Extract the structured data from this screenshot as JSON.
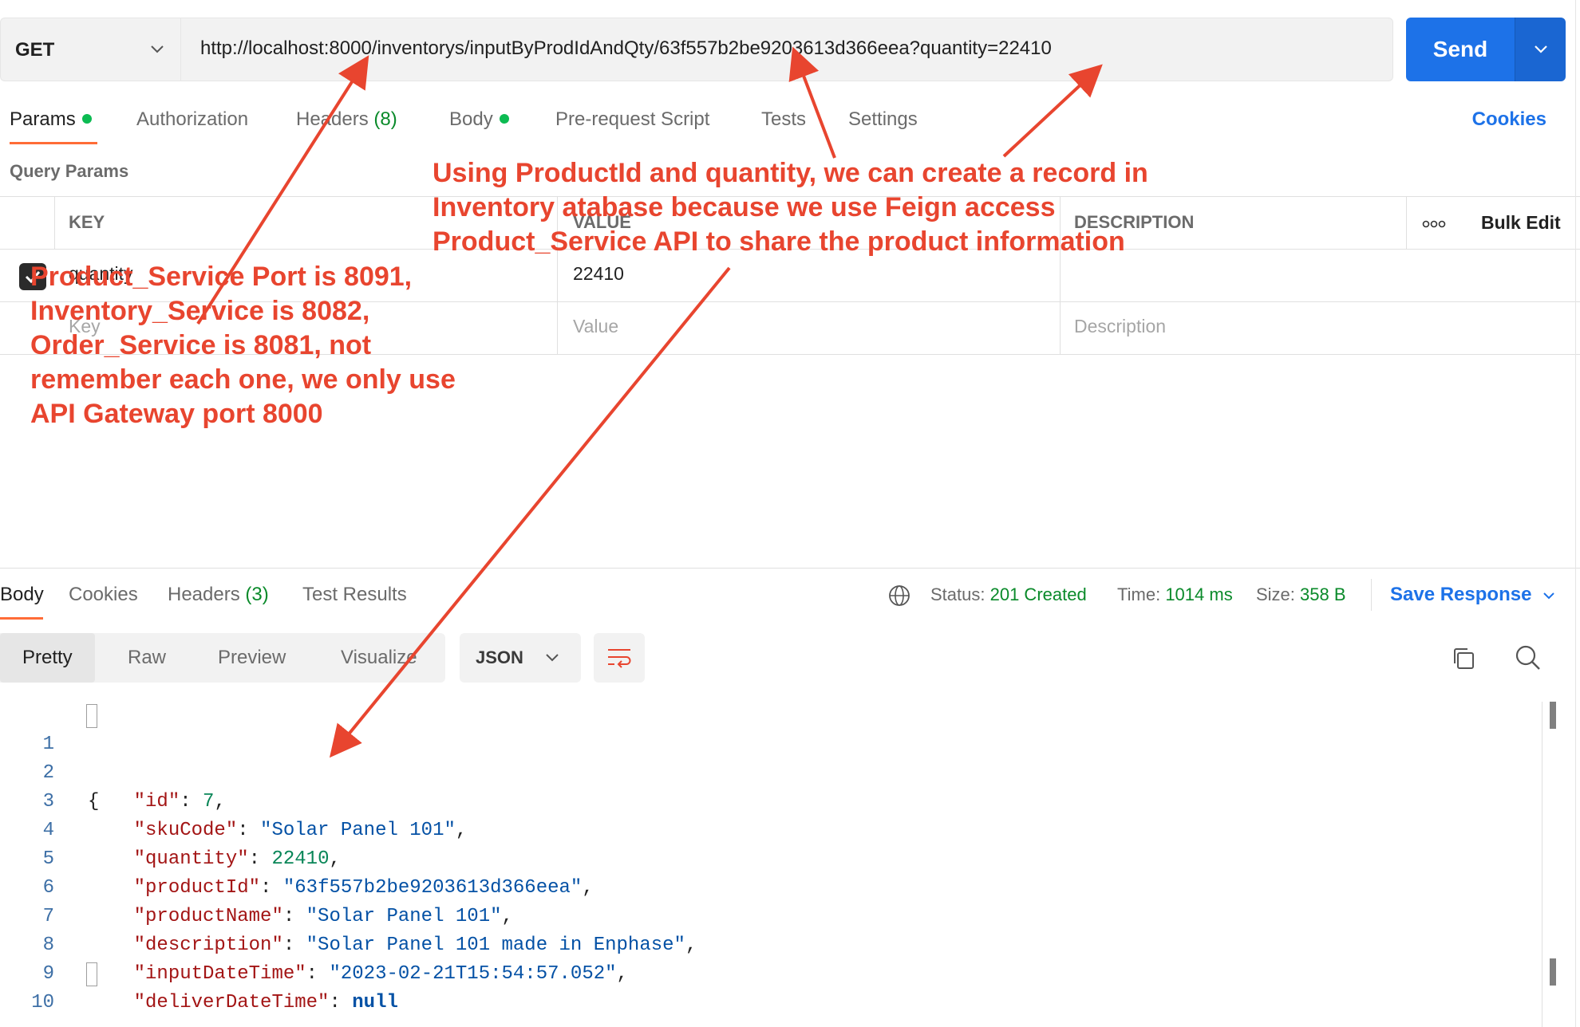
{
  "request": {
    "method": "GET",
    "url": "http://localhost:8000/inventorys/inputByProdIdAndQty/63f557b2be9203613d366eea?quantity=22410",
    "send_label": "Send"
  },
  "request_tabs": {
    "params": "Params",
    "authorization": "Authorization",
    "headers": "Headers",
    "headers_count": "(8)",
    "body": "Body",
    "pre_request": "Pre-request Script",
    "tests": "Tests",
    "settings": "Settings",
    "cookies": "Cookies"
  },
  "query_params": {
    "title": "Query Params",
    "headers": {
      "key": "KEY",
      "value": "VALUE",
      "description": "DESCRIPTION",
      "bulk_edit": "Bulk Edit"
    },
    "rows": [
      {
        "key": "quantity",
        "value": "22410",
        "description": "",
        "checked": true
      }
    ],
    "placeholders": {
      "key": "Key",
      "value": "Value",
      "description": "Description"
    }
  },
  "response_tabs": {
    "body": "Body",
    "cookies": "Cookies",
    "headers": "Headers",
    "headers_count": "(3)",
    "test_results": "Test Results"
  },
  "response_status": {
    "status_label": "Status:",
    "status_value": "201 Created",
    "time_label": "Time:",
    "time_value": "1014 ms",
    "size_label": "Size:",
    "size_value": "358 B",
    "save_response": "Save Response"
  },
  "view_modes": {
    "pretty": "Pretty",
    "raw": "Raw",
    "preview": "Preview",
    "visualize": "Visualize",
    "format": "JSON"
  },
  "response_body": {
    "line_numbers": [
      "1",
      "2",
      "3",
      "4",
      "5",
      "6",
      "7",
      "8",
      "9",
      "10"
    ],
    "open_brace": "{",
    "close_brace": "}",
    "fields": [
      {
        "key": "\"id\"",
        "value": "7",
        "type": "number"
      },
      {
        "key": "\"skuCode\"",
        "value": "\"Solar Panel 101\"",
        "type": "string"
      },
      {
        "key": "\"quantity\"",
        "value": "22410",
        "type": "number"
      },
      {
        "key": "\"productId\"",
        "value": "\"63f557b2be9203613d366eea\"",
        "type": "string"
      },
      {
        "key": "\"productName\"",
        "value": "\"Solar Panel 101\"",
        "type": "string"
      },
      {
        "key": "\"description\"",
        "value": "\"Solar Panel 101 made in Enphase\"",
        "type": "string"
      },
      {
        "key": "\"inputDateTime\"",
        "value": "\"2023-02-21T15:54:57.052\"",
        "type": "string"
      },
      {
        "key": "\"deliverDateTime\"",
        "value": "null",
        "type": "null"
      }
    ]
  },
  "annotations": {
    "top_note": [
      "Using ProductId and quantity, we can create a record in",
      "Inventory atabase because we use Feign access",
      "Product_Service API to share the product information"
    ],
    "left_note": [
      "Product_Service Port is 8091,",
      "Inventory_Service is 8082,",
      "Order_Service is 8081, not",
      "remember each one, we only use",
      "API Gateway port 8000"
    ]
  },
  "colors": {
    "accent": "#ff6c37",
    "send_button": "#1d72e8",
    "success": "#0a8a2a",
    "annotation": "#e8452f",
    "json_key": "#a31515",
    "json_string": "#0451a5",
    "json_number": "#098658"
  },
  "icons": [
    "chevron-down-icon",
    "status-dot-icon",
    "checkbox-checked-icon",
    "more-options-icon",
    "globe-icon",
    "wrap-lines-icon",
    "copy-icon",
    "search-icon"
  ]
}
